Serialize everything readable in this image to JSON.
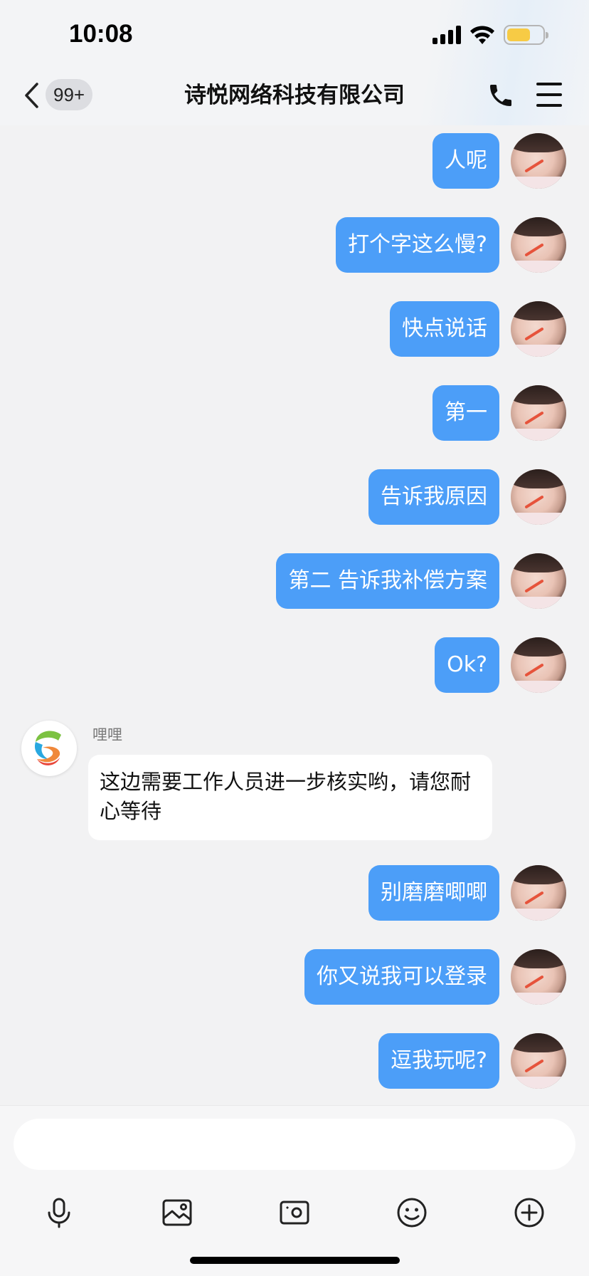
{
  "status_bar": {
    "time": "10:08"
  },
  "header": {
    "unread_badge": "99+",
    "title": "诗悦网络科技有限公司",
    "icons": {
      "back": "chevron-left-icon",
      "call": "phone-icon",
      "menu": "menu-icon"
    }
  },
  "messages_out_1": [
    {
      "text": "人呢"
    },
    {
      "text": "打个字这么慢?"
    },
    {
      "text": "快点说话"
    },
    {
      "text": "第一"
    },
    {
      "text": "告诉我原因"
    },
    {
      "text": "第二 告诉我补偿方案"
    },
    {
      "text": "Ok?"
    }
  ],
  "incoming_message": {
    "sender": "哩哩",
    "text": "这边需要工作人员进一步核实哟，请您耐心等待"
  },
  "messages_out_2": [
    {
      "text": "别磨磨唧唧"
    },
    {
      "text": "你又说我可以登录"
    },
    {
      "text": "逗我玩呢?"
    }
  ],
  "input_bar": {
    "value": "",
    "placeholder": ""
  },
  "toolbar": [
    "microphone-icon",
    "image-icon",
    "camera-icon",
    "emoji-icon",
    "plus-circle-icon"
  ],
  "colors": {
    "outgoing_bubble": "#4c9ef8",
    "incoming_bubble": "#ffffff",
    "background": "#f2f2f3",
    "battery": "#f7cb45"
  }
}
